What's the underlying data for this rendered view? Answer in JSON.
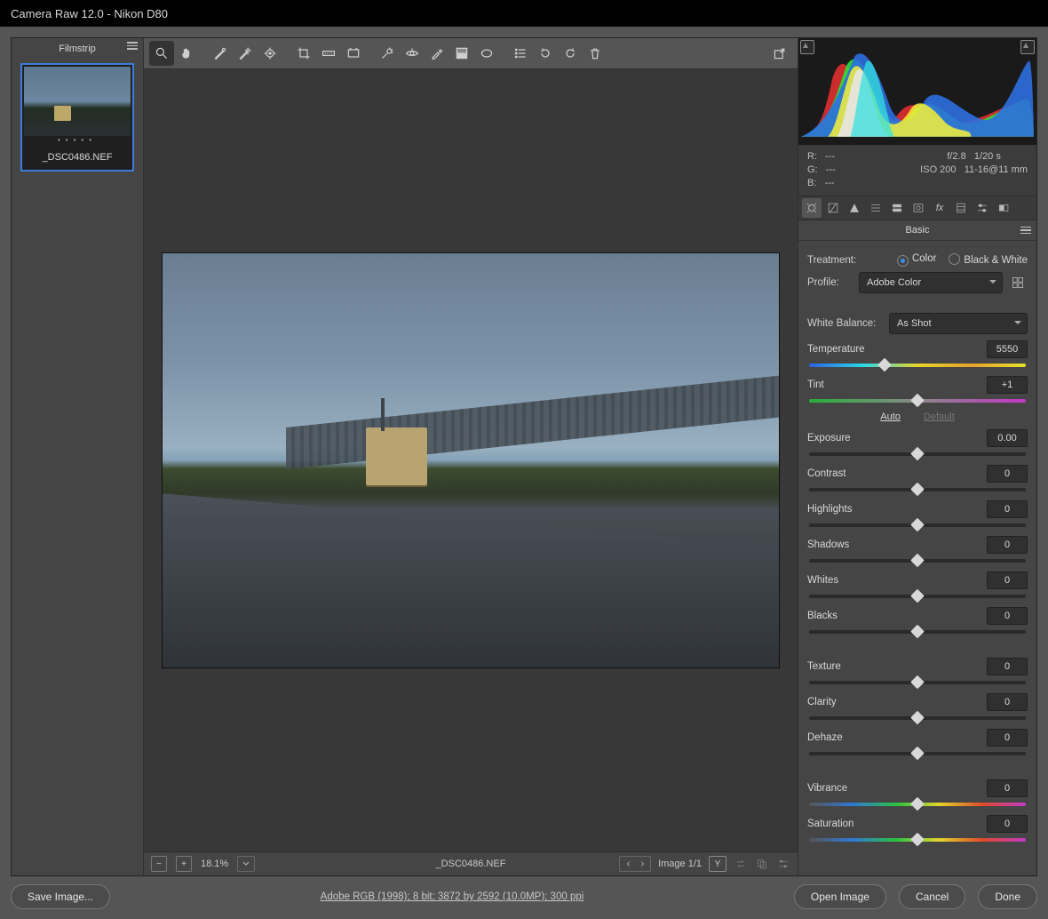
{
  "titlebar": "Camera Raw 12.0  -  Nikon D80",
  "filmstrip": {
    "header": "Filmstrip",
    "thumb_name": "_DSC0486.NEF"
  },
  "statusbar": {
    "zoom": "18.1%",
    "filename": "_DSC0486.NEF",
    "image_counter": "Image 1/1"
  },
  "footer": {
    "save": "Save Image...",
    "meta": "Adobe RGB (1998); 8 bit; 3872 by 2592 (10.0MP); 300 ppi",
    "open": "Open Image",
    "cancel": "Cancel",
    "done": "Done"
  },
  "info": {
    "r_label": "R:",
    "r_val": "---",
    "g_label": "G:",
    "g_val": "---",
    "b_label": "B:",
    "b_val": "---",
    "aperture": "f/2.8",
    "shutter": "1/20 s",
    "iso": "ISO 200",
    "lens": "11-16@11 mm"
  },
  "panel": {
    "title": "Basic",
    "treatment_label": "Treatment:",
    "color": "Color",
    "bw": "Black & White",
    "profile_label": "Profile:",
    "profile_value": "Adobe Color",
    "wb_label": "White Balance:",
    "wb_value": "As Shot",
    "auto": "Auto",
    "default": "Default"
  },
  "sliders": {
    "temperature": {
      "label": "Temperature",
      "value": "5550",
      "pos": 35
    },
    "tint": {
      "label": "Tint",
      "value": "+1",
      "pos": 50
    },
    "exposure": {
      "label": "Exposure",
      "value": "0.00",
      "pos": 50
    },
    "contrast": {
      "label": "Contrast",
      "value": "0",
      "pos": 50
    },
    "highlights": {
      "label": "Highlights",
      "value": "0",
      "pos": 50
    },
    "shadows": {
      "label": "Shadows",
      "value": "0",
      "pos": 50
    },
    "whites": {
      "label": "Whites",
      "value": "0",
      "pos": 50
    },
    "blacks": {
      "label": "Blacks",
      "value": "0",
      "pos": 50
    },
    "texture": {
      "label": "Texture",
      "value": "0",
      "pos": 50
    },
    "clarity": {
      "label": "Clarity",
      "value": "0",
      "pos": 50
    },
    "dehaze": {
      "label": "Dehaze",
      "value": "0",
      "pos": 50
    },
    "vibrance": {
      "label": "Vibrance",
      "value": "0",
      "pos": 50
    },
    "saturation": {
      "label": "Saturation",
      "value": "0",
      "pos": 50
    }
  }
}
